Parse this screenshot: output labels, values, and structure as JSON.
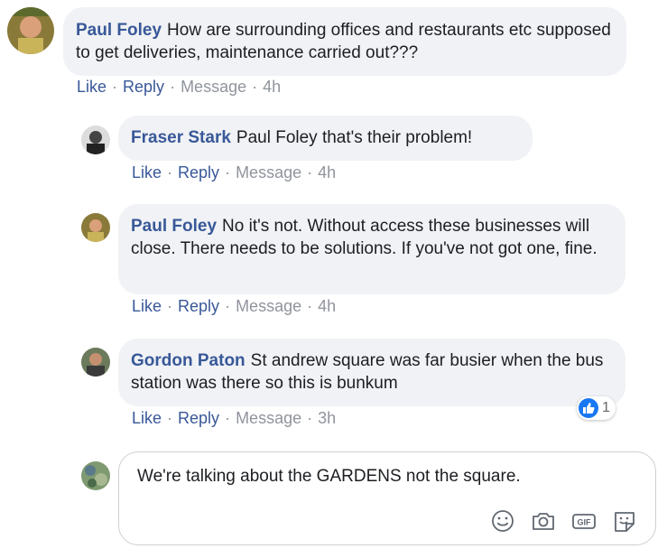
{
  "comments": [
    {
      "author": "Paul Foley",
      "text": "How are surrounding offices and restaurants etc supposed to get deliveries, maintenance carried out???",
      "actions": {
        "like": "Like",
        "reply": "Reply",
        "message": "Message",
        "time": "4h"
      }
    },
    {
      "author": "Fraser Stark",
      "text": "Paul Foley that's their problem!",
      "actions": {
        "like": "Like",
        "reply": "Reply",
        "message": "Message",
        "time": "4h"
      }
    },
    {
      "author": "Paul Foley",
      "text": "No it's not. Without access these businesses will close. There needs to be solutions. If you've not got one, fine.",
      "actions": {
        "like": "Like",
        "reply": "Reply",
        "message": "Message",
        "time": "4h"
      }
    },
    {
      "author": "Gordon Paton",
      "text": "St andrew square was far busier when the bus station was there so this is bunkum",
      "actions": {
        "like": "Like",
        "reply": "Reply",
        "message": "Message",
        "time": "3h"
      },
      "reaction": {
        "icon": "thumbs-up-icon",
        "count": "1"
      }
    }
  ],
  "composer": {
    "text": "We're talking about the GARDENS not the square.",
    "tools": [
      "emoji-icon",
      "camera-icon",
      "gif-icon",
      "sticker-icon"
    ],
    "tool_gif_label": "GIF"
  },
  "colors": {
    "name": "#385898",
    "meta": "#90949c",
    "bubble": "#f0f2f5",
    "like_blue": "#1877f2"
  }
}
